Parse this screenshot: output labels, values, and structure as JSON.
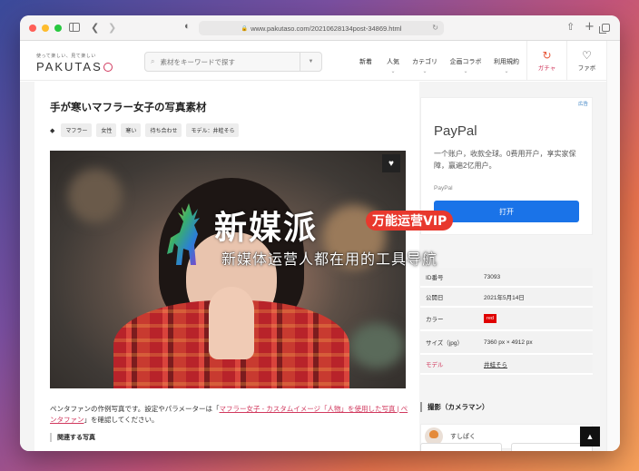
{
  "browser": {
    "url": "www.pakutaso.com/20210628134post-34869.html"
  },
  "header": {
    "logo_tagline": "使って楽しい、見て楽しい",
    "logo": "PAKUTAS",
    "search_placeholder": "素材をキーワードで探す",
    "nav": [
      {
        "label": "新着"
      },
      {
        "label": "人気"
      },
      {
        "label": "カテゴリ"
      },
      {
        "label": "企画コラボ"
      },
      {
        "label": "利用規約"
      }
    ],
    "gacha_label": "ガチャ",
    "fav_label": "ファボ"
  },
  "article": {
    "title": "手が寒いマフラー女子の写真素材",
    "tags": [
      "マフラー",
      "女性",
      "寒い",
      "待ち合わせ",
      "モデル：井蛙そら"
    ],
    "desc_prefix": "ペンタファンの作例写真です。設定やパラメーターは「",
    "desc_link": "マフラー女子 - カスタムイメージ「人物」を使用した写真 | ペンタファン",
    "desc_suffix": "」を確認してください。",
    "related_heading": "関連する写真"
  },
  "ad": {
    "badge": "広告",
    "title": "PayPal",
    "body": "一个账户，收款全球。0费用开户，享实家保障，赢遍2亿用户。",
    "source": "PayPal",
    "button": "打开"
  },
  "info": {
    "rows": [
      {
        "key": "ID番号",
        "value": "73093"
      },
      {
        "key": "公開日",
        "value": "2021年5月14日"
      },
      {
        "key": "カラー",
        "value": "red"
      },
      {
        "key": "サイズ（jpg）",
        "value": "7360 px × 4912 px"
      },
      {
        "key": "モデル",
        "value": "井蛙そら"
      }
    ],
    "color_chip": "#e00000"
  },
  "photographer": {
    "heading": "撮影（カメラマン）",
    "name": "すしぱく"
  },
  "watermark": {
    "brand": "新媒派",
    "badge": "万能运营VIP",
    "sub": "新媒体运营人都在用的工具导航"
  }
}
